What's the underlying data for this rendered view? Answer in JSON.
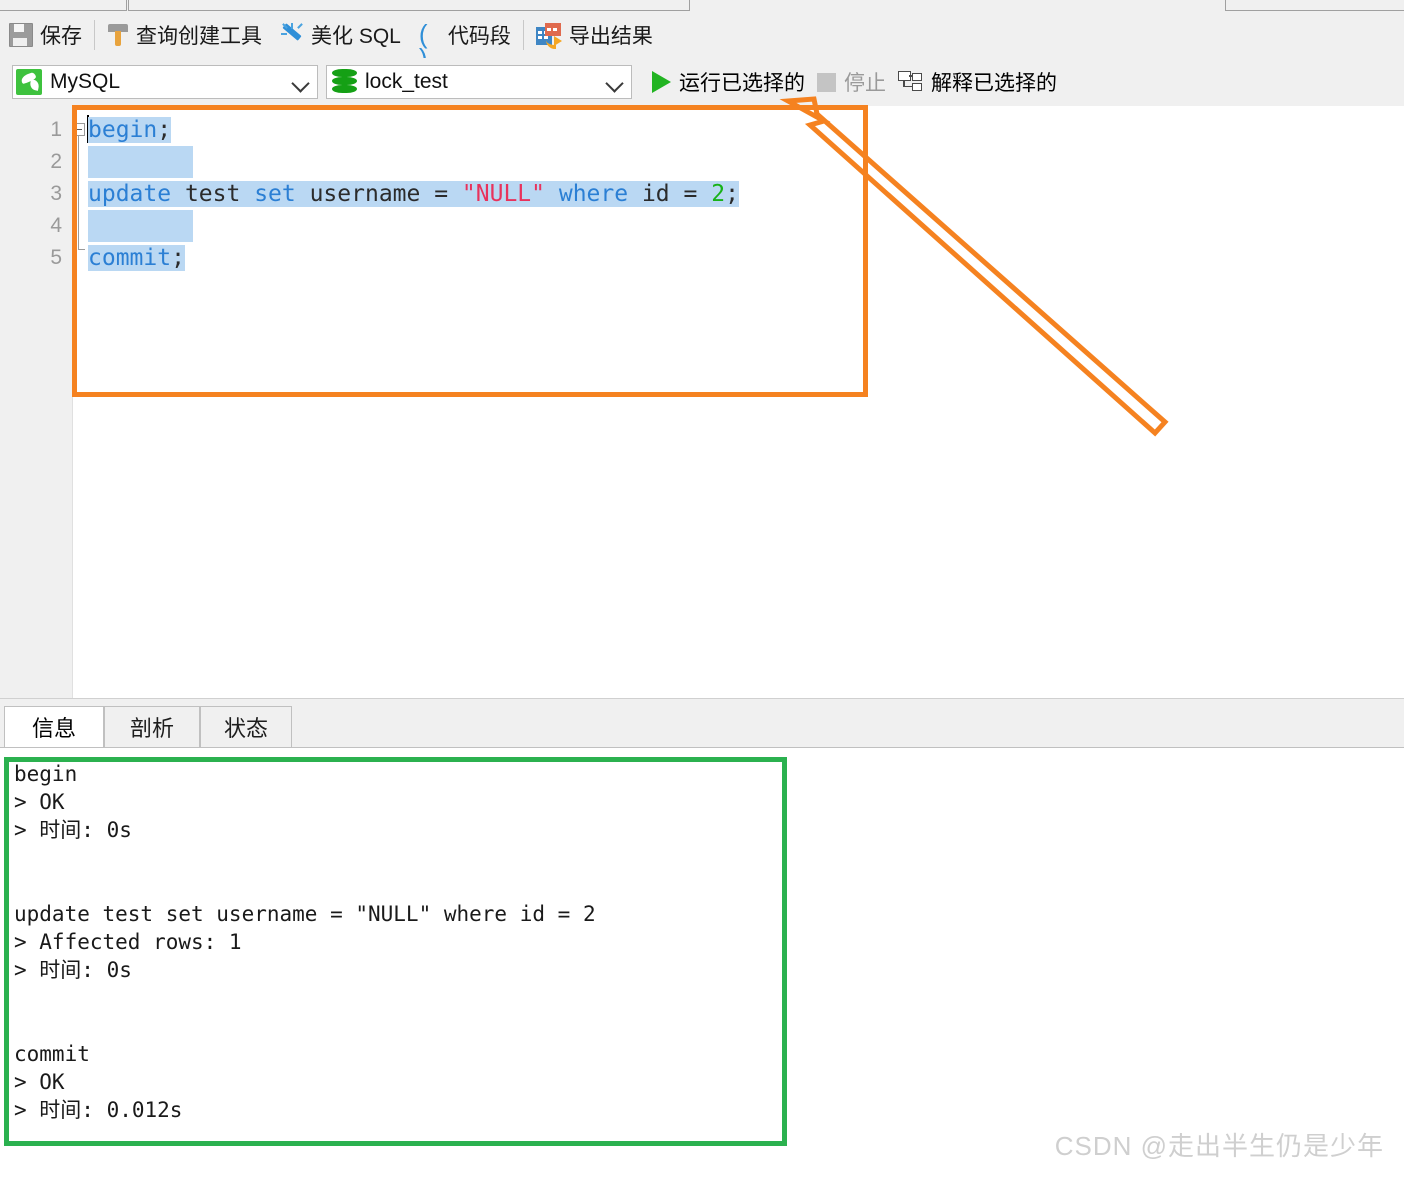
{
  "toolbar": {
    "items": [
      {
        "label": "保存",
        "icon": "save-icon"
      },
      {
        "label": "查询创建工具",
        "icon": "hammer-icon"
      },
      {
        "label": "美化 SQL",
        "icon": "magic-wand-icon"
      },
      {
        "label": "代码段",
        "icon": "parentheses-icon"
      },
      {
        "label": "导出结果",
        "icon": "export-icon"
      }
    ],
    "paren_glyph": "( )"
  },
  "selectors": {
    "connection": {
      "value": "MySQL",
      "icon": "mysql-dolphin-icon"
    },
    "database": {
      "value": "lock_test",
      "icon": "database-icon"
    }
  },
  "actions": {
    "run_selected": "运行已选择的",
    "stop": "停止",
    "explain_selected": "解释已选择的"
  },
  "editor": {
    "line_numbers": [
      "1",
      "2",
      "3",
      "4",
      "5"
    ],
    "lines": [
      {
        "n": "1",
        "tokens": [
          {
            "t": "begin",
            "c": "kw"
          },
          {
            "t": ";",
            "c": "pln"
          }
        ]
      },
      {
        "n": "2",
        "tokens": []
      },
      {
        "n": "3",
        "tokens": [
          {
            "t": "update",
            "c": "kw"
          },
          {
            "t": " test ",
            "c": "pln"
          },
          {
            "t": "set",
            "c": "kw"
          },
          {
            "t": " username = ",
            "c": "pln"
          },
          {
            "t": "\"NULL\"",
            "c": "str"
          },
          {
            "t": " ",
            "c": "pln"
          },
          {
            "t": "where",
            "c": "kw"
          },
          {
            "t": " id = ",
            "c": "pln"
          },
          {
            "t": "2",
            "c": "num"
          },
          {
            "t": ";",
            "c": "pln"
          }
        ]
      },
      {
        "n": "4",
        "tokens": []
      },
      {
        "n": "5",
        "tokens": [
          {
            "t": "commit",
            "c": "kw"
          },
          {
            "t": ";",
            "c": "pln"
          }
        ]
      }
    ],
    "plain_text": "begin;\n\nupdate test set username = \"NULL\" where id = 2;\n\ncommit;"
  },
  "bottom_tabs": [
    {
      "label": "信息",
      "active": true
    },
    {
      "label": "剖析",
      "active": false
    },
    {
      "label": "状态",
      "active": false
    }
  ],
  "log": {
    "text": "begin\n> OK\n> 时间: 0s\n\n\nupdate test set username = \"NULL\" where id = 2\n> Affected rows: 1\n> 时间: 0s\n\n\ncommit\n> OK\n> 时间: 0.012s"
  },
  "annotations": {
    "sql_box_color": "#f58220",
    "log_box_color": "#2bb14f",
    "arrow_color": "#f58220"
  },
  "watermark": "CSDN @走出半生仍是少年"
}
